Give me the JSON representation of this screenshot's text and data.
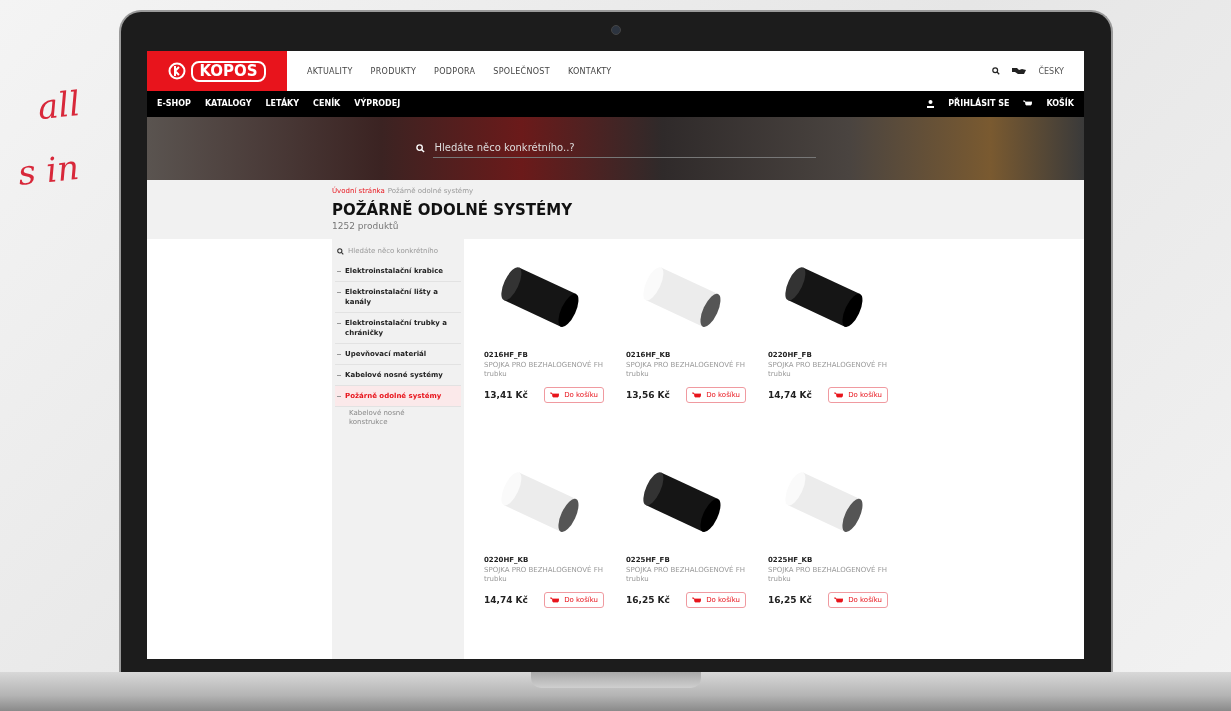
{
  "handwriting": [
    "all",
    "s in"
  ],
  "header": {
    "logo": "KOPOS",
    "nav": [
      {
        "label": "AKTUALITY"
      },
      {
        "label": "PRODUKTY"
      },
      {
        "label": "PODPORA"
      },
      {
        "label": "SPOLEČNOST"
      },
      {
        "label": "KONTAKTY"
      }
    ],
    "language": "ČESKY"
  },
  "subnav": {
    "items": [
      {
        "label": "E-SHOP"
      },
      {
        "label": "KATALOGY"
      },
      {
        "label": "LETÁKY"
      },
      {
        "label": "CENÍK"
      },
      {
        "label": "VÝPRODEJ"
      }
    ],
    "login": "PŘIHLÁSIT SE",
    "cart": "KOŠÍK"
  },
  "hero": {
    "placeholder": "Hledáte něco konkrétního..?"
  },
  "breadcrumb": [
    {
      "label": "Úvodní stránka",
      "selected": false
    },
    {
      "label": "Požárně odolné systémy",
      "selected": true
    }
  ],
  "title": "POŽÁRNĚ ODOLNÉ SYSTÉMY",
  "count": "1252 produktů",
  "sidebar": {
    "search_placeholder": "Hledáte něco konkrétního",
    "items": [
      {
        "label": "Elektroinstalační krabice",
        "selected": false
      },
      {
        "label": "Elektroinstalační lišty a kanály",
        "selected": false
      },
      {
        "label": "Elektroinstalační trubky a chráničky",
        "selected": false
      },
      {
        "label": "Upevňovací materiál",
        "selected": false
      },
      {
        "label": "Kabelové nosné systémy",
        "selected": false
      },
      {
        "label": "Požárně odolné systémy",
        "selected": true,
        "children": [
          {
            "label": "Kabelové nosné konstrukce"
          }
        ]
      }
    ]
  },
  "products": [
    {
      "kind": "black",
      "code": "0216HF_FB",
      "description": "SPOJKA PRO BEZHALOGENOVÉ FH trubku",
      "price": "13,41 Kč",
      "button": "Do košíku"
    },
    {
      "kind": "white",
      "code": "0216HF_KB",
      "description": "SPOJKA PRO BEZHALOGENOVÉ FH trubku",
      "price": "13,56 Kč",
      "button": "Do košíku"
    },
    {
      "kind": "black",
      "code": "0220HF_FB",
      "description": "SPOJKA PRO BEZHALOGENOVÉ FH trubku",
      "price": "14,74 Kč",
      "button": "Do košíku"
    },
    {
      "kind": "white",
      "code": "0220HF_KB",
      "description": "SPOJKA PRO BEZHALOGENOVÉ FH trubku",
      "price": "14,74 Kč",
      "button": "Do košíku"
    },
    {
      "kind": "black",
      "code": "0225HF_FB",
      "description": "SPOJKA PRO BEZHALOGENOVÉ FH trubku",
      "price": "16,25 Kč",
      "button": "Do košíku"
    },
    {
      "kind": "white",
      "code": "0225HF_KB",
      "description": "SPOJKA PRO BEZHALOGENOVÉ FH trubku",
      "price": "16,25 Kč",
      "button": "Do košíku"
    }
  ]
}
